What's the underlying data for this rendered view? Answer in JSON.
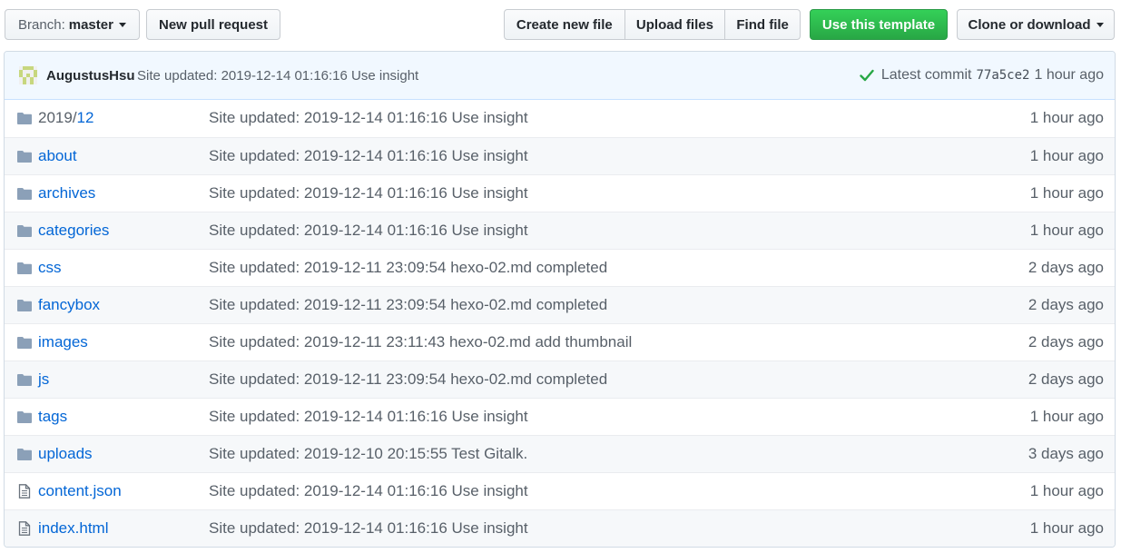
{
  "toolbar": {
    "branch_prefix": "Branch:",
    "branch_name": "master",
    "new_pull_request": "New pull request",
    "create_new_file": "Create new file",
    "upload_files": "Upload files",
    "find_file": "Find file",
    "use_template": "Use this template",
    "clone_download": "Clone or download"
  },
  "commit": {
    "author": "AugustusHsu",
    "message": "Site updated: 2019-12-14 01:16:16 Use insight",
    "latest_label": "Latest commit",
    "sha": "77a5ce2",
    "time": "1 hour ago"
  },
  "colors": {
    "link": "#0366d6",
    "muted": "#586069",
    "success": "#28a745",
    "commit_bar_bg": "#f1f8ff"
  },
  "files": [
    {
      "type": "folder",
      "icon": "folder-icon",
      "prefix": "2019/",
      "name": "12",
      "message": "Site updated: 2019-12-14 01:16:16 Use insight",
      "age": "1 hour ago"
    },
    {
      "type": "folder",
      "icon": "folder-icon",
      "prefix": "",
      "name": "about",
      "message": "Site updated: 2019-12-14 01:16:16 Use insight",
      "age": "1 hour ago"
    },
    {
      "type": "folder",
      "icon": "folder-icon",
      "prefix": "",
      "name": "archives",
      "message": "Site updated: 2019-12-14 01:16:16 Use insight",
      "age": "1 hour ago"
    },
    {
      "type": "folder",
      "icon": "folder-icon",
      "prefix": "",
      "name": "categories",
      "message": "Site updated: 2019-12-14 01:16:16 Use insight",
      "age": "1 hour ago"
    },
    {
      "type": "folder",
      "icon": "folder-icon",
      "prefix": "",
      "name": "css",
      "message": "Site updated: 2019-12-11 23:09:54 hexo-02.md completed",
      "age": "2 days ago"
    },
    {
      "type": "folder",
      "icon": "folder-icon",
      "prefix": "",
      "name": "fancybox",
      "message": "Site updated: 2019-12-11 23:09:54 hexo-02.md completed",
      "age": "2 days ago"
    },
    {
      "type": "folder",
      "icon": "folder-icon",
      "prefix": "",
      "name": "images",
      "message": "Site updated: 2019-12-11 23:11:43 hexo-02.md add thumbnail",
      "age": "2 days ago"
    },
    {
      "type": "folder",
      "icon": "folder-icon",
      "prefix": "",
      "name": "js",
      "message": "Site updated: 2019-12-11 23:09:54 hexo-02.md completed",
      "age": "2 days ago"
    },
    {
      "type": "folder",
      "icon": "folder-icon",
      "prefix": "",
      "name": "tags",
      "message": "Site updated: 2019-12-14 01:16:16 Use insight",
      "age": "1 hour ago"
    },
    {
      "type": "folder",
      "icon": "folder-icon",
      "prefix": "",
      "name": "uploads",
      "message": "Site updated: 2019-12-10 20:15:55 Test Gitalk.",
      "age": "3 days ago"
    },
    {
      "type": "file",
      "icon": "file-icon",
      "prefix": "",
      "name": "content.json",
      "message": "Site updated: 2019-12-14 01:16:16 Use insight",
      "age": "1 hour ago"
    },
    {
      "type": "file",
      "icon": "file-icon",
      "prefix": "",
      "name": "index.html",
      "message": "Site updated: 2019-12-14 01:16:16 Use insight",
      "age": "1 hour ago"
    }
  ]
}
